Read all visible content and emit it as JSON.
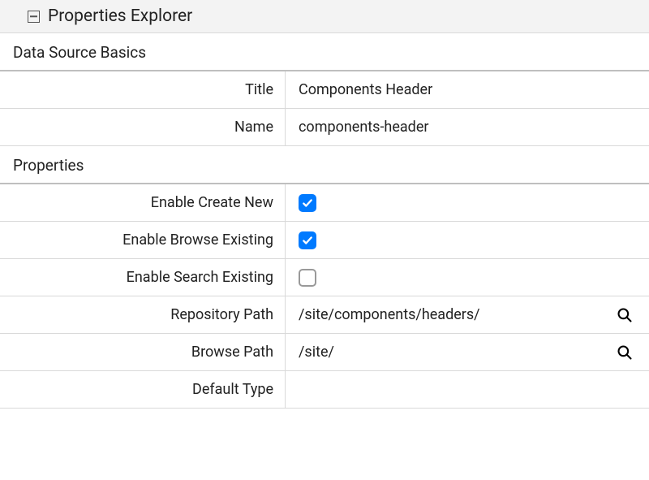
{
  "header": {
    "title": "Properties Explorer"
  },
  "sections": {
    "basics": {
      "title": "Data Source Basics",
      "rows": {
        "title": {
          "label": "Title",
          "value": "Components Header"
        },
        "name": {
          "label": "Name",
          "value": "components-header"
        }
      }
    },
    "properties": {
      "title": "Properties",
      "rows": {
        "enable_create_new": {
          "label": "Enable Create New",
          "checked": true
        },
        "enable_browse_existing": {
          "label": "Enable Browse Existing",
          "checked": true
        },
        "enable_search_existing": {
          "label": "Enable Search Existing",
          "checked": false
        },
        "repository_path": {
          "label": "Repository Path",
          "value": "/site/components/headers/"
        },
        "browse_path": {
          "label": "Browse Path",
          "value": "/site/"
        },
        "default_type": {
          "label": "Default Type",
          "value": ""
        }
      }
    }
  }
}
